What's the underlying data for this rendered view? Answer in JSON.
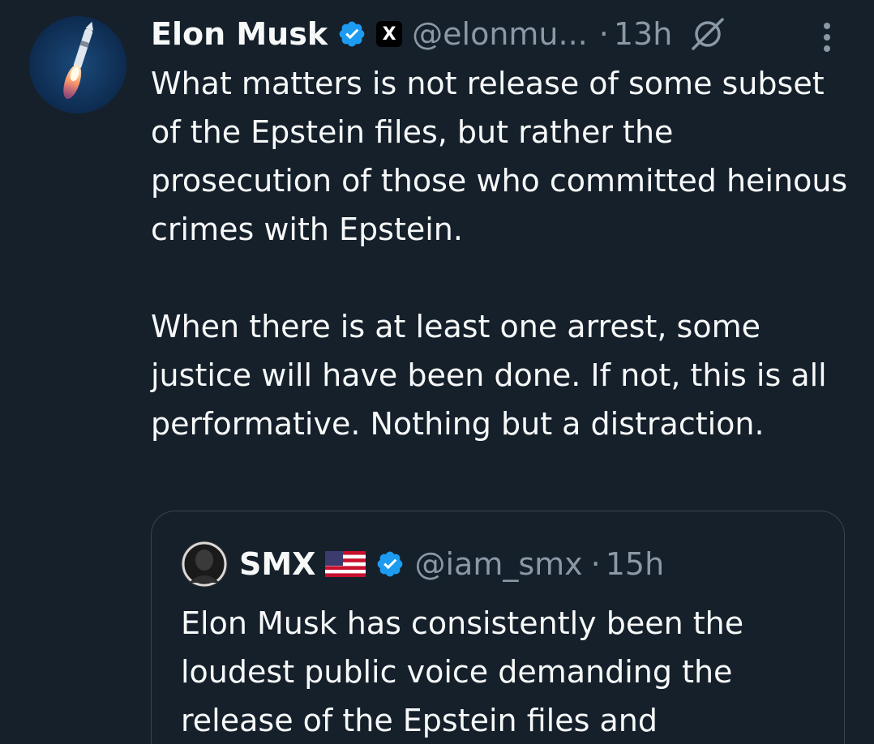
{
  "tweet": {
    "author_name": "Elon Musk",
    "handle": "@elonmu...",
    "separator": "·",
    "time": "13h",
    "affiliation_badge": "X",
    "paragraphs": [
      "What matters is not release of some subset of the Epstein files, but rather the prosecution of those who committed heinous crimes with Epstein.",
      "When there is at least one arrest, some justice will have been done. If not, this is all performative. Nothing but a distraction."
    ]
  },
  "quoted": {
    "author_name": "SMX",
    "handle": "@iam_smx",
    "separator": "·",
    "time": "15h",
    "text": "Elon Musk has consistently been the loudest public voice demanding the release of the Epstein files and"
  },
  "icons": {
    "verified": "verified-badge-icon",
    "grok": "grok-icon",
    "more": "more-vertical-icon",
    "flag": "us-flag-icon"
  },
  "colors": {
    "background": "#15202b",
    "text": "#f7f9f9",
    "muted": "#8b98a5",
    "verified": "#1d9bf0",
    "border": "#38444d"
  }
}
